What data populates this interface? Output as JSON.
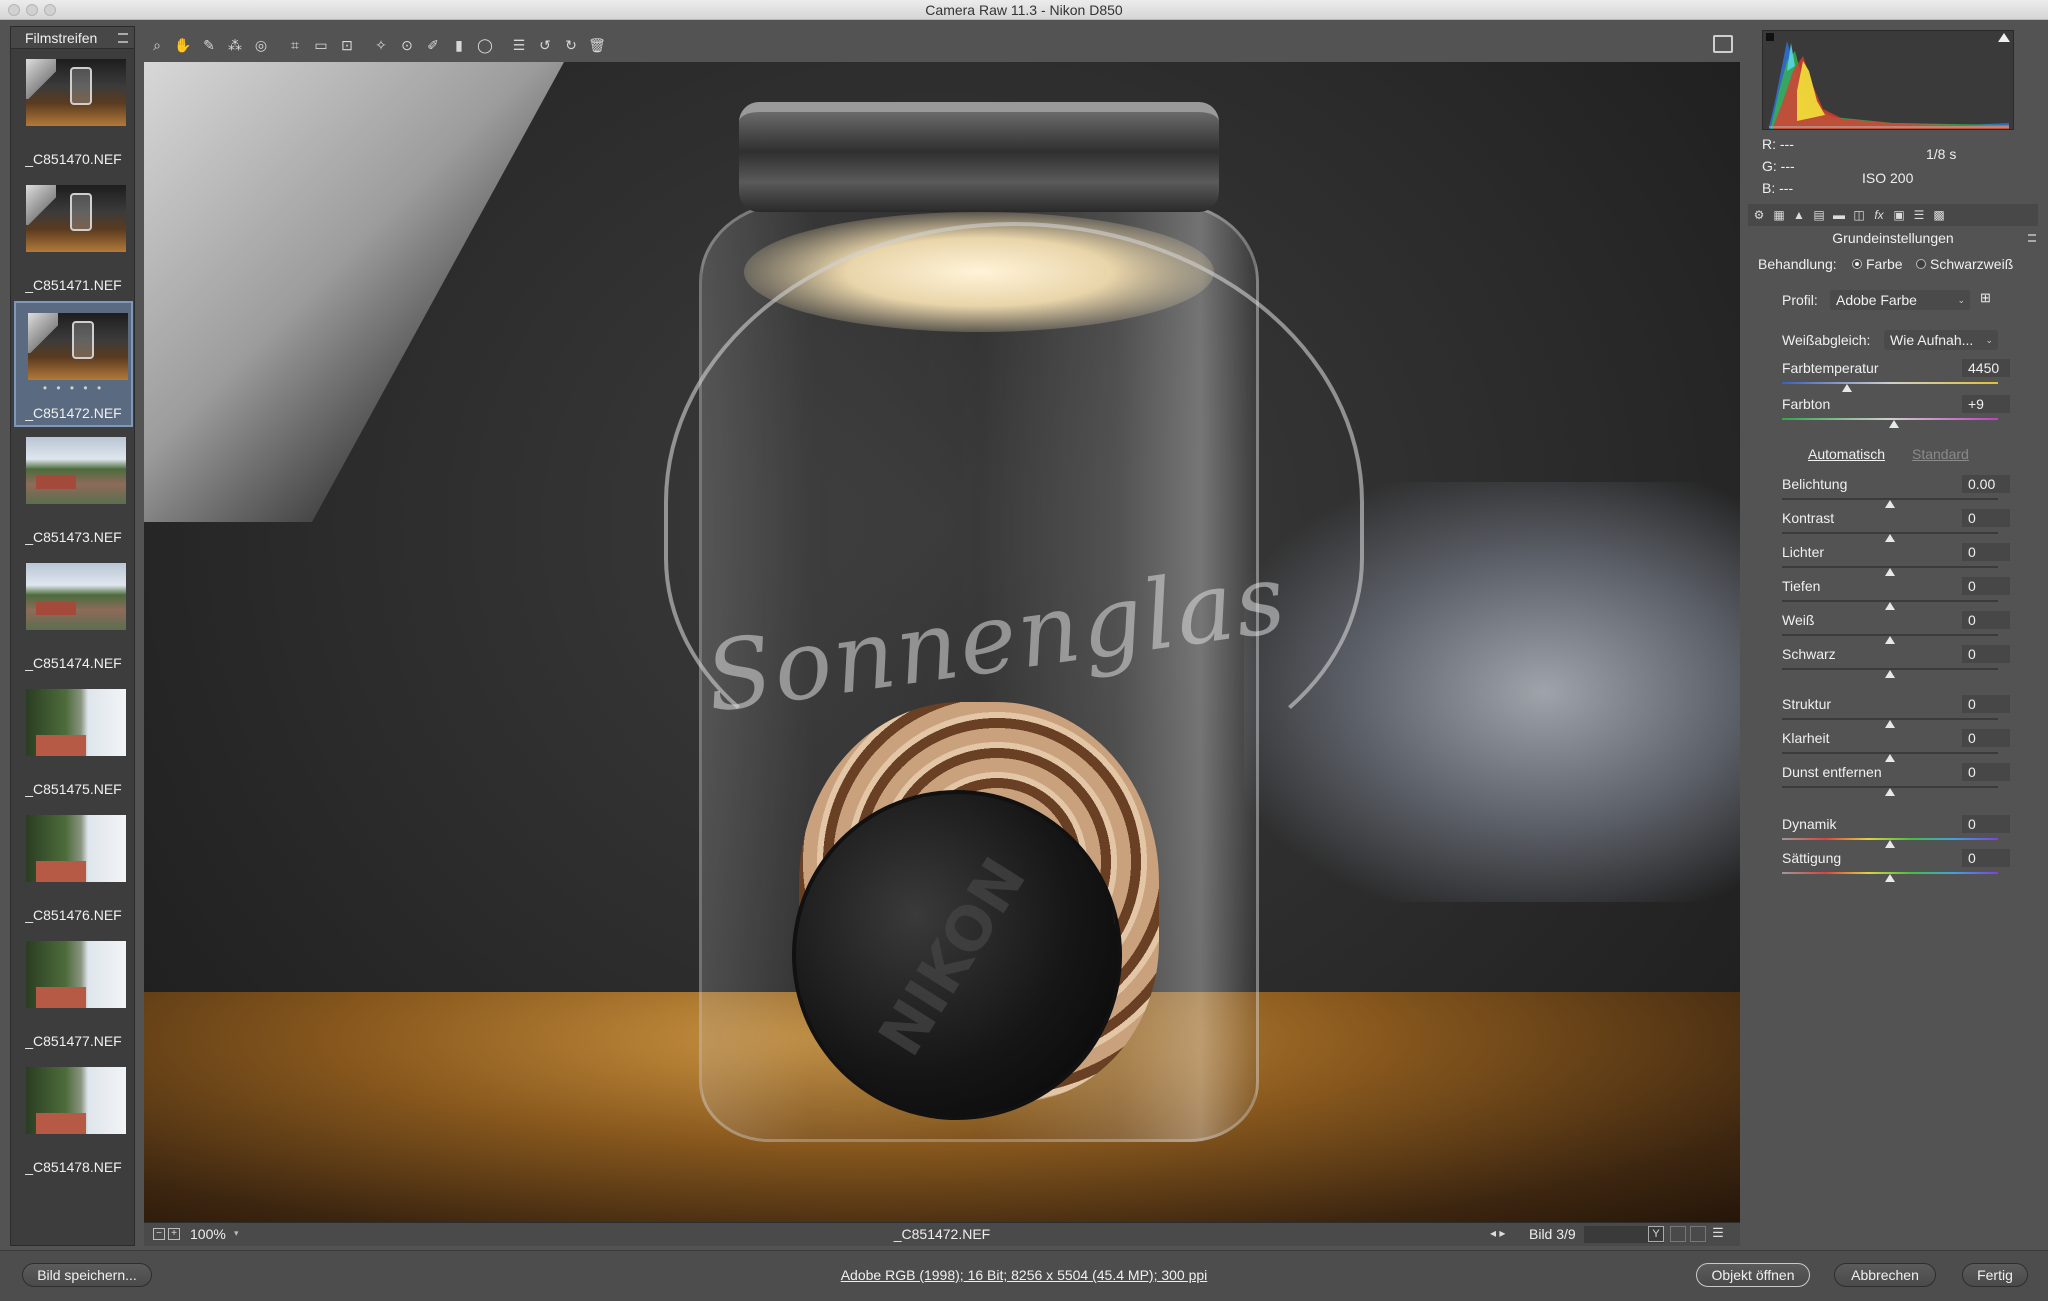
{
  "window": {
    "title": "Camera Raw 11.3 - Nikon D850"
  },
  "filmstrip": {
    "title": "Filmstreifen",
    "items": [
      {
        "name": "_C851470.NEF",
        "thumb": "jar",
        "selected": false
      },
      {
        "name": "_C851471.NEF",
        "thumb": "jar",
        "selected": false
      },
      {
        "name": "_C851472.NEF",
        "thumb": "jar",
        "selected": true,
        "rating": "• • • • •"
      },
      {
        "name": "_C851473.NEF",
        "thumb": "town",
        "selected": false
      },
      {
        "name": "_C851474.NEF",
        "thumb": "town",
        "selected": false
      },
      {
        "name": "_C851475.NEF",
        "thumb": "tree",
        "selected": false
      },
      {
        "name": "_C851476.NEF",
        "thumb": "tree",
        "selected": false
      },
      {
        "name": "_C851477.NEF",
        "thumb": "tree",
        "selected": false
      },
      {
        "name": "_C851478.NEF",
        "thumb": "tree",
        "selected": false
      }
    ]
  },
  "toolbar": {
    "tools": [
      {
        "name": "zoom-tool-icon",
        "glyph": "⌕"
      },
      {
        "name": "hand-tool-icon",
        "glyph": "✋"
      },
      {
        "name": "white-balance-tool-icon",
        "glyph": "✎"
      },
      {
        "name": "color-sampler-tool-icon",
        "glyph": "⁂"
      },
      {
        "name": "targeted-adjustment-tool-icon",
        "glyph": "◎"
      },
      {
        "name": "crop-tool-icon",
        "glyph": "⌗"
      },
      {
        "name": "straighten-tool-icon",
        "glyph": "▭"
      },
      {
        "name": "transform-tool-icon",
        "glyph": "⊡"
      },
      {
        "name": "spot-removal-tool-icon",
        "glyph": "✧"
      },
      {
        "name": "red-eye-removal-icon",
        "glyph": "⊙"
      },
      {
        "name": "adjustment-brush-icon",
        "glyph": "✐"
      },
      {
        "name": "graduated-filter-icon",
        "glyph": "▮"
      },
      {
        "name": "radial-filter-icon",
        "glyph": "◯"
      },
      {
        "name": "preferences-icon",
        "glyph": "☰"
      },
      {
        "name": "rotate-left-icon",
        "glyph": "↺"
      },
      {
        "name": "rotate-right-icon",
        "glyph": "↻"
      },
      {
        "name": "trash-icon",
        "glyph": "🗑"
      }
    ]
  },
  "image": {
    "script_text": "Sonnenglas",
    "cap_text": "NIKON"
  },
  "status": {
    "zoom": "100%",
    "filename": "_C851472.NEF",
    "nav": "◂ ▸",
    "image_index": "Bild 3/9",
    "y_label": "Y"
  },
  "bottom": {
    "save": "Bild speichern...",
    "workflow": "Adobe RGB (1998); 16 Bit; 8256 x 5504 (45.4 MP); 300 ppi",
    "open": "Objekt öffnen",
    "cancel": "Abbrechen",
    "done": "Fertig"
  },
  "histogram": {
    "r_label": "R:",
    "r_val": "---",
    "g_label": "G:",
    "g_val": "---",
    "b_label": "B:",
    "b_val": "---",
    "shutter": "1/8 s",
    "iso": "ISO 200"
  },
  "panel": {
    "title": "Grundeinstellungen",
    "treatment_label": "Behandlung:",
    "treatment_color": "Farbe",
    "treatment_bw": "Schwarzweiß",
    "profile_label": "Profil:",
    "profile_value": "Adobe Farbe",
    "wb_label": "Weißabgleich:",
    "wb_value": "Wie Aufnah...",
    "auto": "Automatisch",
    "default": "Standard",
    "sliders": [
      {
        "label": "Farbtemperatur",
        "value": "4450",
        "pos": 0.3,
        "track": "temp"
      },
      {
        "label": "Farbton",
        "value": "+9",
        "pos": 0.52,
        "track": "tint"
      },
      {
        "label": "Belichtung",
        "value": "0.00",
        "pos": 0.5,
        "track": "plain"
      },
      {
        "label": "Kontrast",
        "value": "0",
        "pos": 0.5,
        "track": "plain"
      },
      {
        "label": "Lichter",
        "value": "0",
        "pos": 0.5,
        "track": "plain"
      },
      {
        "label": "Tiefen",
        "value": "0",
        "pos": 0.5,
        "track": "plain"
      },
      {
        "label": "Weiß",
        "value": "0",
        "pos": 0.5,
        "track": "plain"
      },
      {
        "label": "Schwarz",
        "value": "0",
        "pos": 0.5,
        "track": "plain"
      },
      {
        "label": "Struktur",
        "value": "0",
        "pos": 0.5,
        "track": "plain"
      },
      {
        "label": "Klarheit",
        "value": "0",
        "pos": 0.5,
        "track": "plain"
      },
      {
        "label": "Dunst entfernen",
        "value": "0",
        "pos": 0.5,
        "track": "plain"
      },
      {
        "label": "Dynamik",
        "value": "0",
        "pos": 0.5,
        "track": "sat"
      },
      {
        "label": "Sättigung",
        "value": "0",
        "pos": 0.5,
        "track": "sat"
      }
    ]
  },
  "colors": {
    "selection": "#7f97b8",
    "panel_bg": "#535353"
  }
}
